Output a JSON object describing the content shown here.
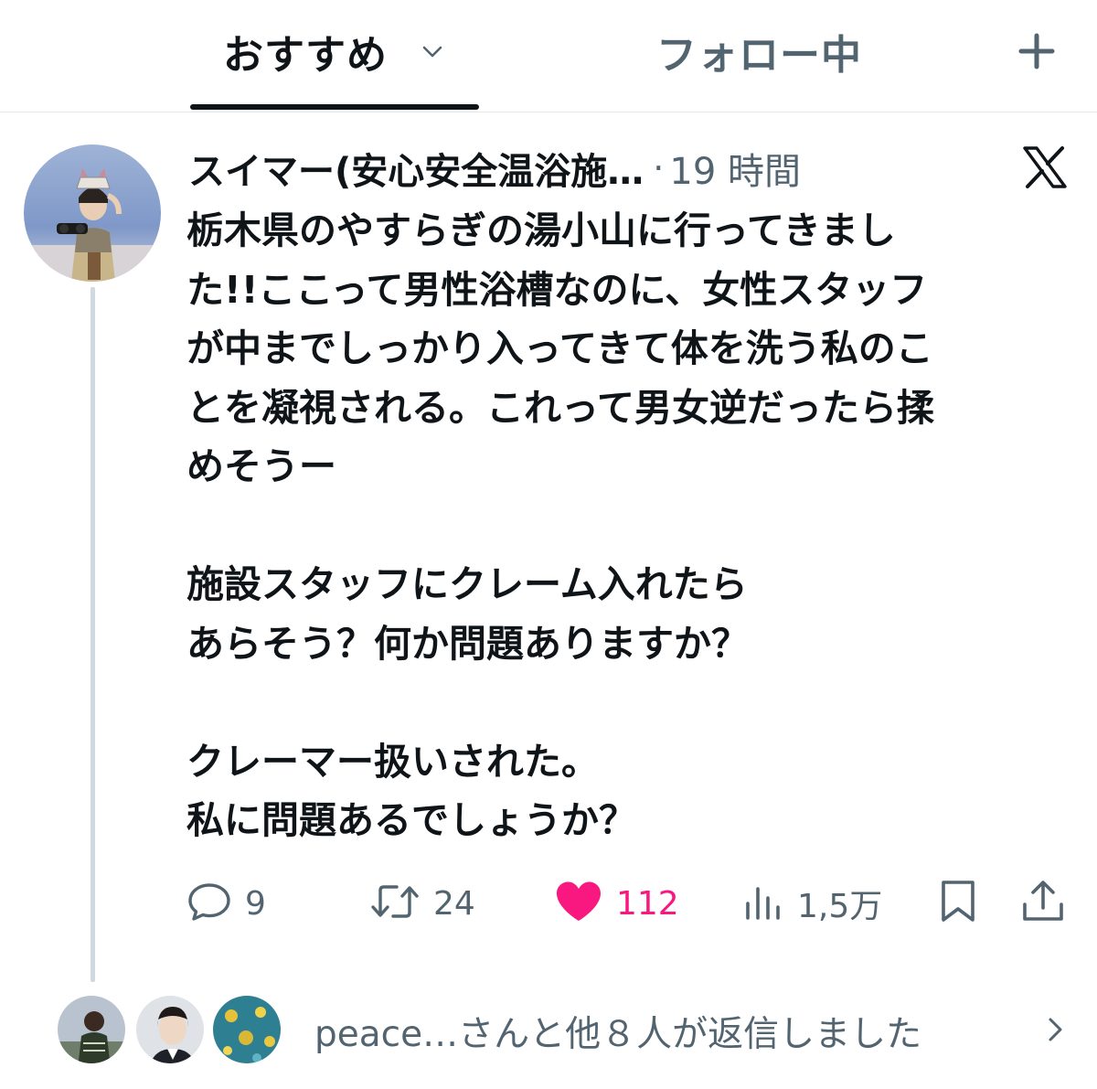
{
  "tabs": {
    "recommended": "おすすめ",
    "following": "フォロー中"
  },
  "icons": {
    "tab_dropdown": "chevron-down-icon",
    "add": "plus-icon",
    "platform": "x-logo-icon",
    "reply": "reply-bubble-icon",
    "retweet": "retweet-icon",
    "like": "heart-icon",
    "views": "views-bar-chart-icon",
    "bookmark": "bookmark-icon",
    "share": "share-icon",
    "more_replies": "chevron-right-icon"
  },
  "tweet": {
    "author_name": "スイマー(安心安全温浴施…",
    "separator": "·",
    "timestamp": "19 時間",
    "body_lines": [
      "栃木県のやすらぎの湯小山に行ってきまし",
      "た!!ここって男性浴槽なのに、女性スタッフ",
      "が中までしっかり入ってきて体を洗う私のこ",
      "とを凝視される。これって男女逆だったら揉",
      "めそうー",
      "",
      "施設スタッフにクレーム入れたら",
      "あらそう？何か問題ありますか？",
      "",
      "クレーマー扱いされた。",
      "私に問題あるでしょうか？"
    ],
    "stats": {
      "replies": "9",
      "retweets": "24",
      "likes": "112",
      "views": "1,5万"
    }
  },
  "replies_summary": "peace…さんと他８人が返信しました",
  "colors": {
    "text_primary": "#0f1419",
    "text_secondary": "#536471",
    "like_pink": "#f91880",
    "divider": "#e6e9eb",
    "thread_line": "#cfd9de"
  }
}
